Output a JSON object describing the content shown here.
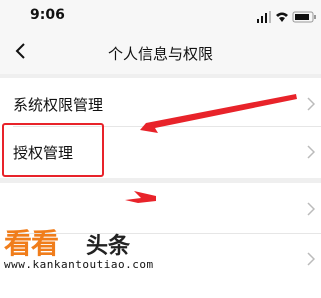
{
  "status_bar": {
    "time": "9:06"
  },
  "nav": {
    "title": "个人信息与权限"
  },
  "settings_group_1": {
    "items": [
      {
        "label": "系统权限管理"
      },
      {
        "label": "授权管理"
      }
    ]
  },
  "watermark": {
    "main": "看看",
    "sub": "头条",
    "url": "www.kankantoutiao.com"
  },
  "colors": {
    "annotation": "#e8232a",
    "watermark": "#f07d1b"
  }
}
